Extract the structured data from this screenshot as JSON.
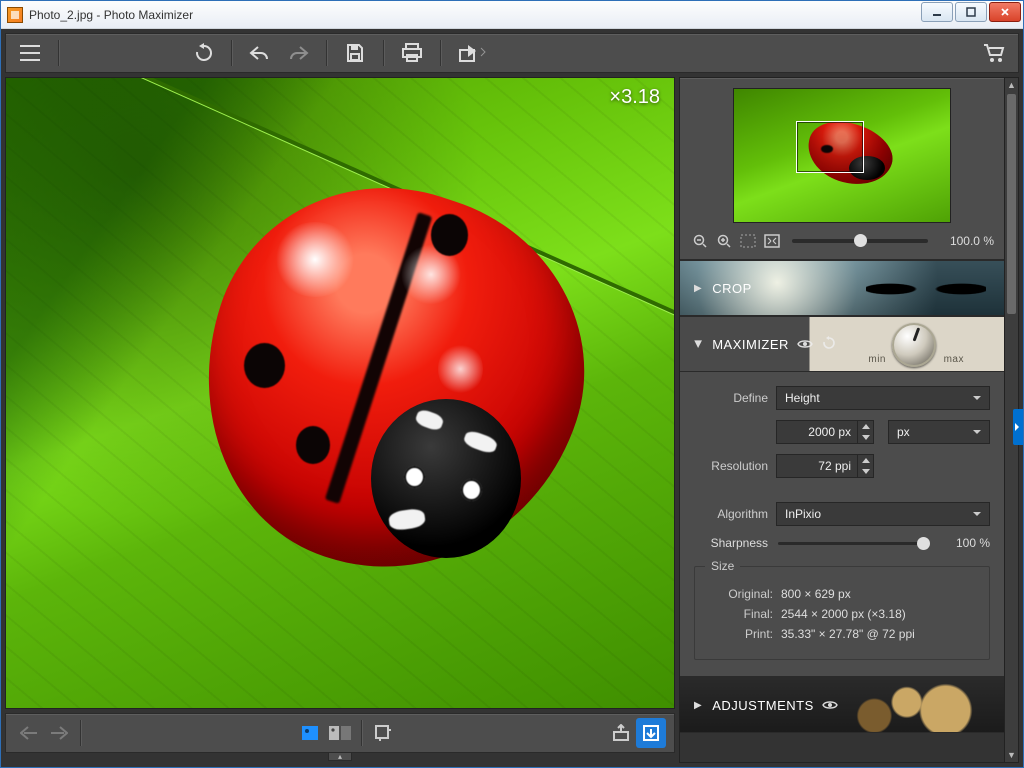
{
  "window": {
    "title": "Photo_2.jpg - Photo Maximizer"
  },
  "toolbar": {
    "menu": "menu",
    "reset": "reset",
    "undo": "undo",
    "redo": "redo",
    "save": "save",
    "print": "print",
    "share": "share",
    "buy": "buy"
  },
  "canvas": {
    "zoom_label": "×3.18"
  },
  "navigator": {
    "zoom_pct": "100.0 %"
  },
  "sections": {
    "crop": {
      "title": "CROP"
    },
    "maximizer": {
      "title": "MAXIMIZER",
      "min_label": "min",
      "max_label": "max",
      "define_label": "Define",
      "define_value": "Height",
      "size_value": "2000 px",
      "unit_value": "px",
      "resolution_label": "Resolution",
      "resolution_value": "72 ppi",
      "algorithm_label": "Algorithm",
      "algorithm_value": "InPixio",
      "sharpness_label": "Sharpness",
      "sharpness_value": "100 %",
      "sizebox": {
        "legend": "Size",
        "original_key": "Original:",
        "original_val": "800 × 629 px",
        "final_key": "Final:",
        "final_val": "2544 × 2000 px (×3.18)",
        "print_key": "Print:",
        "print_val": "35.33\" × 27.78\" @ 72 ppi"
      }
    },
    "adjustments": {
      "title": "ADJUSTMENTS"
    }
  }
}
